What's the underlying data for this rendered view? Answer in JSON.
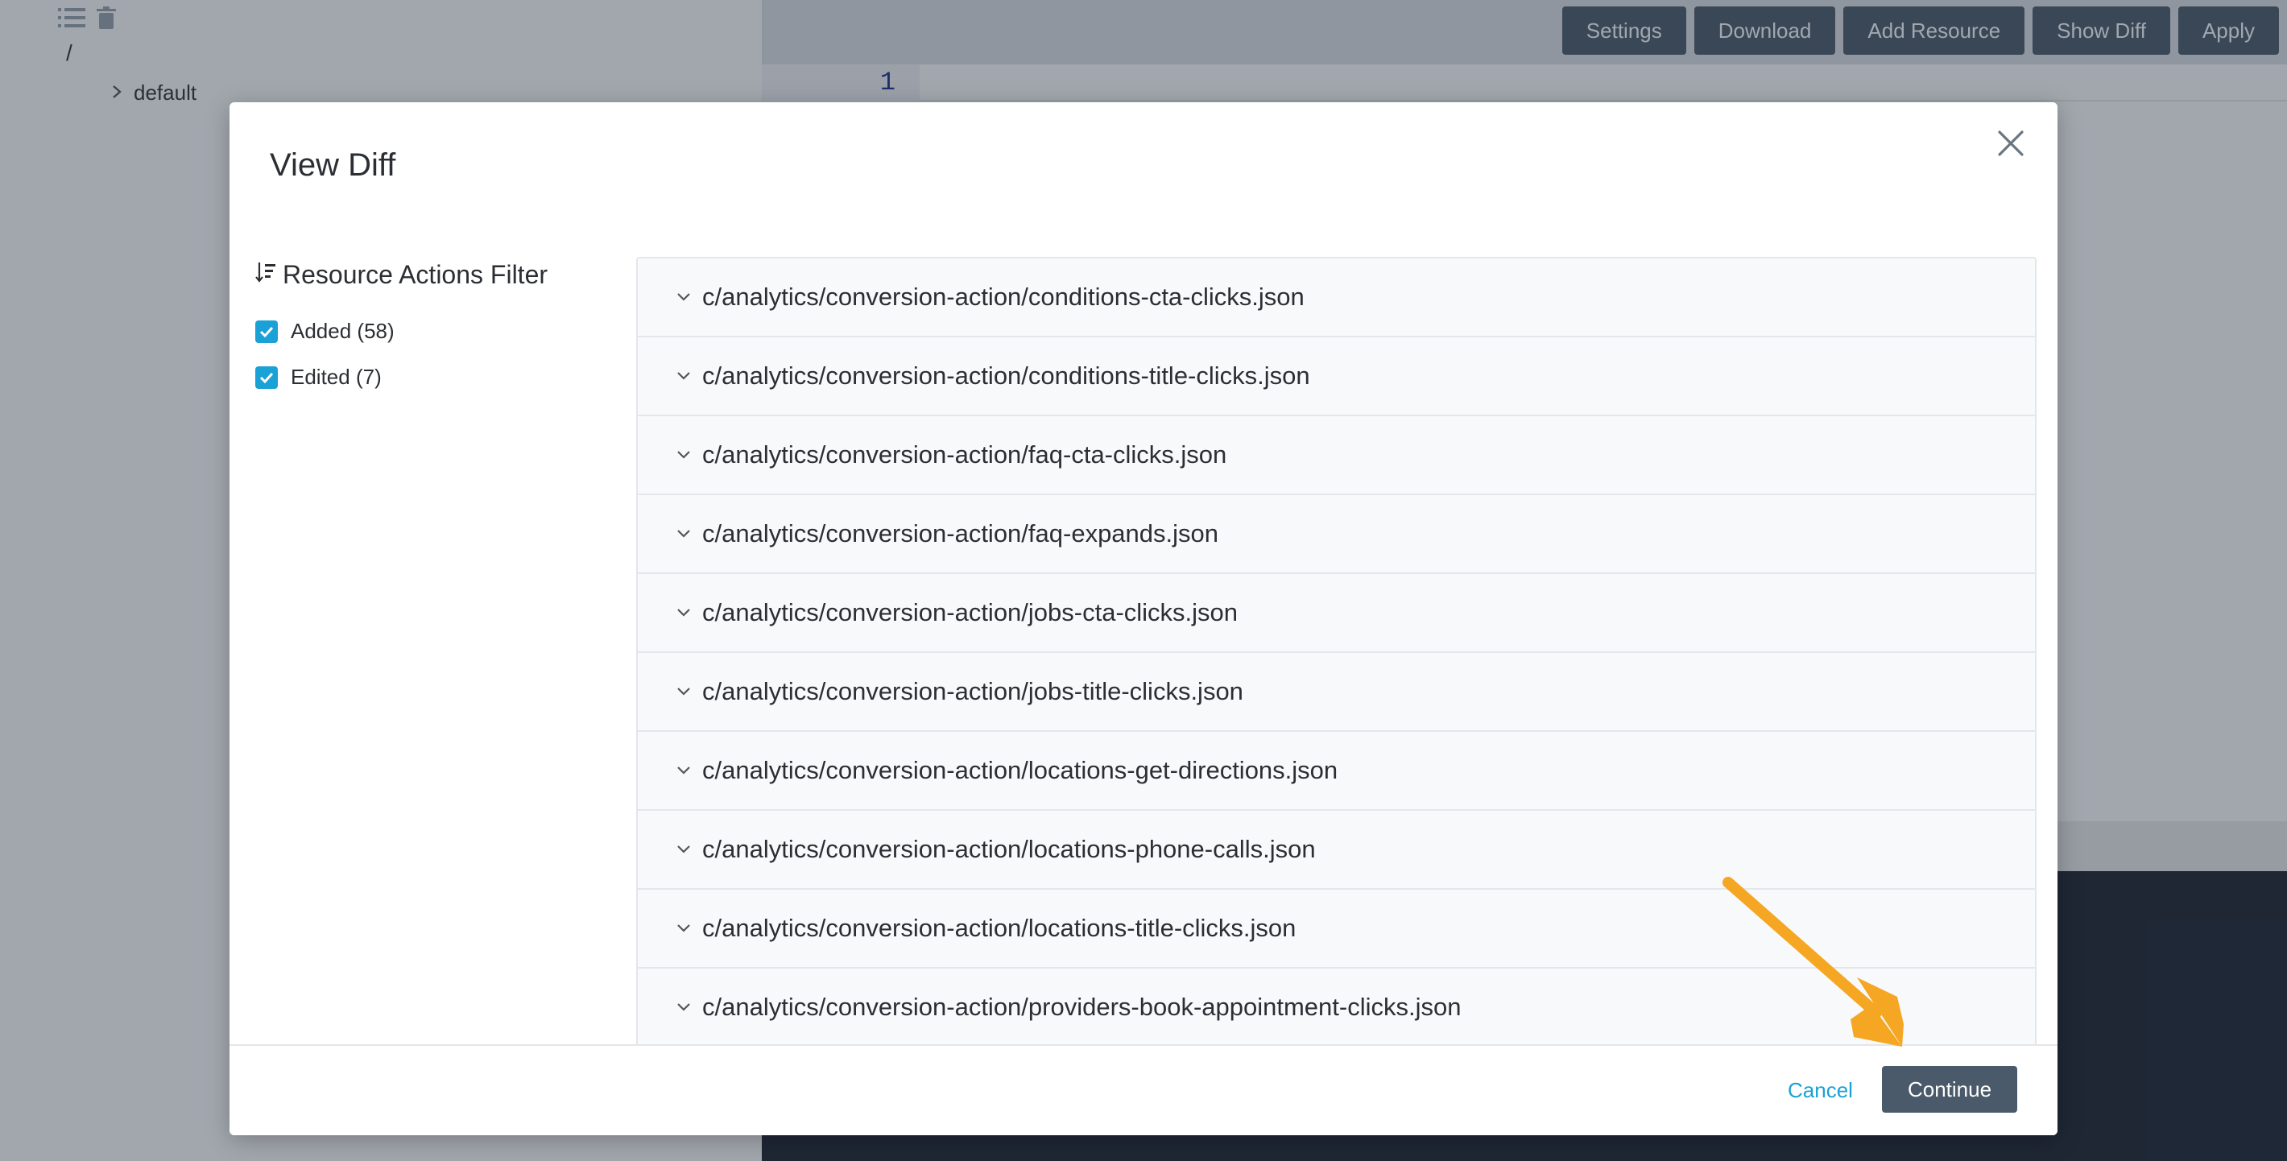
{
  "tree": {
    "root_label": "/",
    "node_label": "default"
  },
  "toolbar": {
    "buttons": [
      "Settings",
      "Download",
      "Add Resource",
      "Show Diff",
      "Apply"
    ]
  },
  "editor": {
    "line_number": "1"
  },
  "modal": {
    "title": "View Diff",
    "filter": {
      "heading": "Resource Actions Filter",
      "options": [
        {
          "label": "Added (58)",
          "checked": true
        },
        {
          "label": "Edited (7)",
          "checked": true
        }
      ]
    },
    "diff_items": [
      "c/analytics/conversion-action/conditions-cta-clicks.json",
      "c/analytics/conversion-action/conditions-title-clicks.json",
      "c/analytics/conversion-action/faq-cta-clicks.json",
      "c/analytics/conversion-action/faq-expands.json",
      "c/analytics/conversion-action/jobs-cta-clicks.json",
      "c/analytics/conversion-action/jobs-title-clicks.json",
      "c/analytics/conversion-action/locations-get-directions.json",
      "c/analytics/conversion-action/locations-phone-calls.json",
      "c/analytics/conversion-action/locations-title-clicks.json",
      "c/analytics/conversion-action/providers-book-appointment-clicks.json"
    ],
    "cancel_label": "Cancel",
    "continue_label": "Continue"
  },
  "colors": {
    "accent": "#1aa1d6",
    "button": "#4a5a6a",
    "annotation_arrow": "#f5a623"
  },
  "icons": {
    "tree_toolbar": [
      "list-icon",
      "trash-icon"
    ],
    "filter": "sort-icon",
    "close": "close-icon",
    "diff_item": "chevron-down-icon"
  }
}
